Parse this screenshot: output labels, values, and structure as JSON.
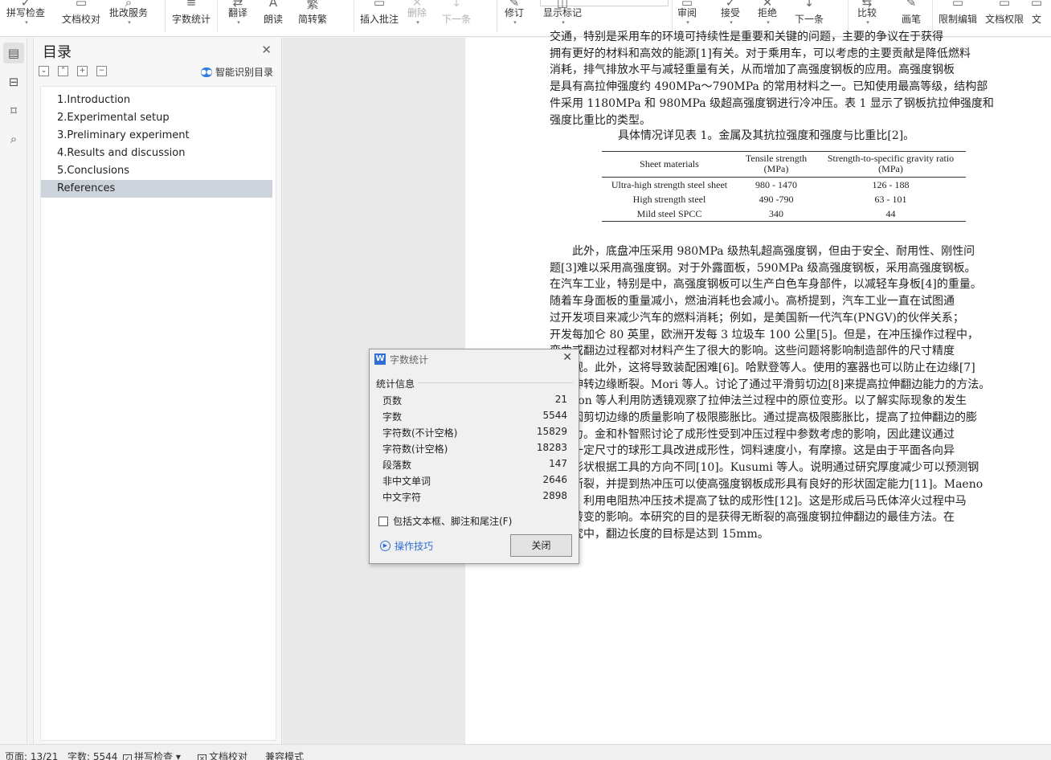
{
  "ribbon": {
    "buttons": [
      {
        "label": "拼写检查",
        "icon": "check-icon",
        "dropdown": true
      },
      {
        "label": "文档校对",
        "icon": "proofread-icon",
        "dropdown": false
      },
      {
        "label": "批改服务",
        "icon": "review-service-icon",
        "dropdown": true
      },
      {
        "label": "字数统计",
        "icon": "word-count-icon",
        "dropdown": false
      },
      {
        "label": "翻译",
        "icon": "translate-icon",
        "dropdown": true
      },
      {
        "label": "朗读",
        "icon": "read-aloud-icon",
        "dropdown": false
      },
      {
        "label": "简转繁",
        "icon": "simplified-traditional-icon",
        "dropdown": false
      },
      {
        "label": "插入批注",
        "icon": "comment-icon",
        "dropdown": false
      },
      {
        "label": "删除",
        "icon": "delete-comment-icon",
        "dropdown": true
      },
      {
        "label": "下一条",
        "icon": "next-comment-icon",
        "dropdown": false
      },
      {
        "label": "修订",
        "icon": "track-changes-icon",
        "dropdown": true
      },
      {
        "label": "显示标记",
        "icon": "show-markup-icon",
        "dropdown": true
      },
      {
        "label": "审阅",
        "icon": "review-icon",
        "dropdown": true
      },
      {
        "label": "接受",
        "icon": "accept-icon",
        "dropdown": true
      },
      {
        "label": "拒绝",
        "icon": "reject-icon",
        "dropdown": true
      },
      {
        "label": "下一条",
        "icon": "next-change-icon",
        "dropdown": false
      },
      {
        "label": "比较",
        "icon": "compare-icon",
        "dropdown": true
      },
      {
        "label": "画笔",
        "icon": "pen-icon",
        "dropdown": false
      },
      {
        "label": "限制编辑",
        "icon": "restrict-edit-icon",
        "dropdown": false
      },
      {
        "label": "文档权限",
        "icon": "document-permission-icon",
        "dropdown": false
      },
      {
        "label": "文",
        "icon": "more-icon",
        "dropdown": false
      }
    ]
  },
  "toc": {
    "title": "目录",
    "smart_label": "智能识别目录",
    "items": [
      "1.Introduction",
      "2.Experimental setup",
      "3.Preliminary experiment",
      "4.Results and discussion",
      "5.Conclusions",
      "References"
    ]
  },
  "document": {
    "para1": [
      "交通，特别是采用车的环境可持续性是重要和关键的问题，主要的争议在于获得",
      "拥有更好的材料和高效的能源[1]有关。对于乘用车，可以考虑的主要贡献是降低燃料",
      "消耗，排气排放水平与减轻重量有关，从而增加了高强度钢板的应用。高强度钢板",
      "是具有高拉伸强度约 490MPa～790MPa 的常用材料之一。已知使用最高等级，结构部",
      "件采用 1180MPa 和 980MPa 级超高强度钢进行冷冲压。表 1 显示了钢板抗拉伸强度和",
      "强度比重比的类型。"
    ],
    "caption": "具体情况详见表 1。金属及其抗拉强度和强度与比重比[2]。",
    "table": {
      "headers": [
        "Sheet materials",
        "Tensile strength (MPa)",
        "Strength-to-specific gravity ratio (MPa)"
      ],
      "rows": [
        [
          "Ultra-high strength steel sheet",
          "980 - 1470",
          "126 - 188"
        ],
        [
          "High strength steel",
          "490 -790",
          "63 - 101"
        ],
        [
          "Mild steel SPCC",
          "340",
          "44"
        ]
      ]
    },
    "para2": [
      "　　此外，底盘冲压采用 980MPa 级热轧超高强度钢，但由于安全、耐用性、刚性问",
      "题[3]难以采用高强度钢。对于外露面板，590MPa 级高强度钢板，采用高强度钢板。",
      "在汽车工业，特别是中，高强度钢板可以生产白色车身部件，以减轻车身板[4]的重量。",
      "随着车身面板的重量减小，燃油消耗也会减小。高桥提到，汽车工业一直在试图通",
      "过开发项目来减少汽车的燃料消耗；例如，是美国新一代汽车(PNGV)的伙伴关系；",
      "开发每加仑 80 英里，欧洲开发每 3 垃圾车 100 公里[5]。但是，在冲压操作过程中，",
      "弯曲或翻边过程都对材料产生了很大的影响。这些问题将影响制造部件的尺寸精度",
      "和外观。此外，这将导致装配困难[6]。哈默登等人。使用的塞器也可以防止在边缘[7]",
      "的拉伸转边缘断裂。Mori 等人。讨论了通过平滑剪切边[8]来提高拉伸翻边能力的方法。",
      "Gordon 等人利用防透镜观察了拉伸法兰过程中的原位变形。以了解实际现象的发生",
      "的原因剪切边缘的质量影响了极限膨胀比。通过提高极限膨胀比，提高了拉伸翻边的膨",
      "胀能力。金和朴智熙讨论了成形性受到冲压过程中参数考虑的影响，因此建议通过",
      "使用一定尺寸的球形工具改进成形性，饲料速度小，有摩擦。这是由于平面各向异",
      "性，形状根据工具的方向不同[10]。Kusumi 等人。说明通过研究厚度减少可以预测钢",
      "板的断裂，并提到热冲压可以使高强度钢板成形具有良好的形状固定能力[11]。Maeno",
      "等人，利用电阻热冲压技术提高了钛的成形性[12]。这是形成后马氏体淬火过程中马",
      "氏体转变的影响。本研究的目的是获得无断裂的高强度钢拉伸翻边的最佳方法。在",
      "本研究中，翻边长度的目标是达到 15mm。"
    ]
  },
  "dialog": {
    "title": "字数统计",
    "section": "统计信息",
    "stats": [
      {
        "label": "页数",
        "value": "21"
      },
      {
        "label": "字数",
        "value": "5544"
      },
      {
        "label": "字符数(不计空格)",
        "value": "15829"
      },
      {
        "label": "字符数(计空格)",
        "value": "18283"
      },
      {
        "label": "段落数",
        "value": "147"
      },
      {
        "label": "非中文单词",
        "value": "2646"
      },
      {
        "label": "中文字符",
        "value": "2898"
      }
    ],
    "checkbox_label": "包括文本框、脚注和尾注(F)",
    "checkbox_checked": false,
    "tips_label": "操作技巧",
    "close_label": "关闭"
  },
  "status": {
    "page": "页面: 13/21",
    "words": "字数: 5544",
    "spell": "拼写检查",
    "proof": "文档校对",
    "compat": "兼容模式"
  }
}
